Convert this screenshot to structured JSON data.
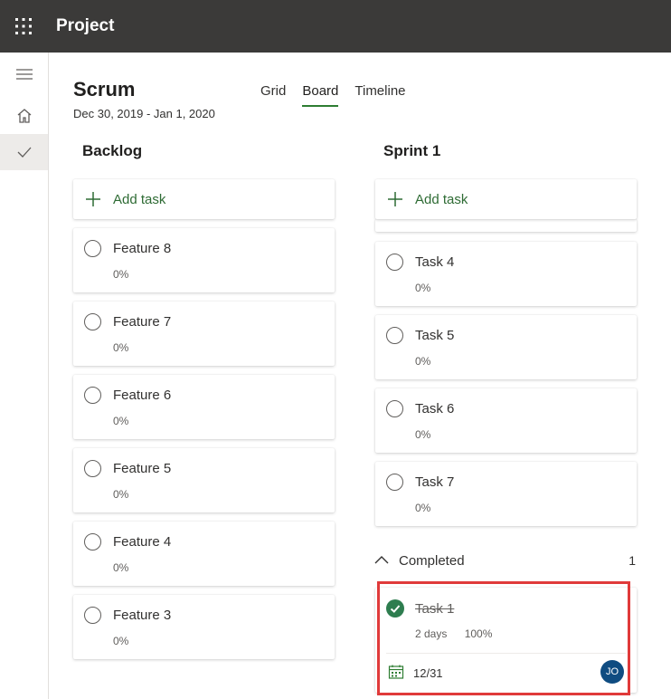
{
  "app": {
    "title": "Project"
  },
  "plan": {
    "title": "Scrum",
    "dates": "Dec 30, 2019 - Jan 1, 2020"
  },
  "tabs": [
    {
      "label": "Grid",
      "selected": false
    },
    {
      "label": "Board",
      "selected": true
    },
    {
      "label": "Timeline",
      "selected": false
    }
  ],
  "colors": {
    "topbar": "#3b3a39",
    "accent_green": "#2e7d32",
    "done_check": "#2e7d4f",
    "avatar": "#0f4c81",
    "highlight_border": "#e03a3a"
  },
  "icons": {
    "waffle": "app-launcher-icon",
    "menu": "hamburger-icon",
    "home": "home-icon",
    "tasks": "checkmark-icon",
    "add": "plus-icon",
    "calendar": "calendar-icon",
    "collapse": "chevron-up-icon"
  },
  "backlog": {
    "title": "Backlog",
    "add_label": "Add task",
    "tasks": [
      {
        "name": "Feature 8",
        "progress": "0%"
      },
      {
        "name": "Feature 7",
        "progress": "0%"
      },
      {
        "name": "Feature 6",
        "progress": "0%"
      },
      {
        "name": "Feature 5",
        "progress": "0%"
      },
      {
        "name": "Feature 4",
        "progress": "0%"
      },
      {
        "name": "Feature 3",
        "progress": "0%"
      }
    ]
  },
  "sprint1": {
    "title": "Sprint 1",
    "add_label": "Add task",
    "tasks": [
      {
        "name": "Task 4",
        "progress": "0%"
      },
      {
        "name": "Task 5",
        "progress": "0%"
      },
      {
        "name": "Task 6",
        "progress": "0%"
      },
      {
        "name": "Task 7",
        "progress": "0%"
      }
    ],
    "completed": {
      "label": "Completed",
      "count": "1",
      "task": {
        "name": "Task 1",
        "duration": "2 days",
        "progress": "100%",
        "due": "12/31",
        "assignee_initials": "JO"
      }
    }
  }
}
